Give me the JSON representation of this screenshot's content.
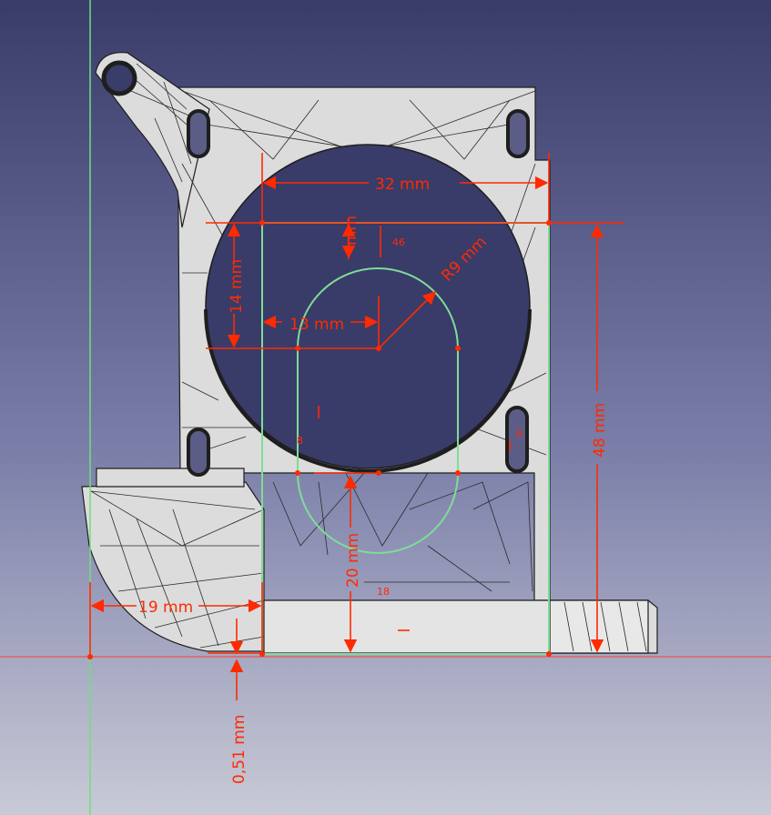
{
  "view": {
    "background_top": "#3a3c6a",
    "background_bottom": "#c6c8d4",
    "part_fill": "#dcdcdc",
    "part_edge": "#1e1e1e",
    "sketch_color": "#7fdc98",
    "dimension_color": "#ff2a00",
    "axis_color": "#6ee07a"
  },
  "dimensions": {
    "width_32": "32 mm",
    "height_14": "14 mm",
    "offset_13": "13 mm",
    "radius_r9": "R9 mm",
    "height_48": "48 mm",
    "offset_19": "19 mm",
    "height_20": "20 mm",
    "gap_051": "0,51 mm",
    "small_mm": "mm",
    "constraint_46": "46",
    "constraint_18": "18",
    "constraint_6": "6",
    "constraint_8": "8"
  }
}
